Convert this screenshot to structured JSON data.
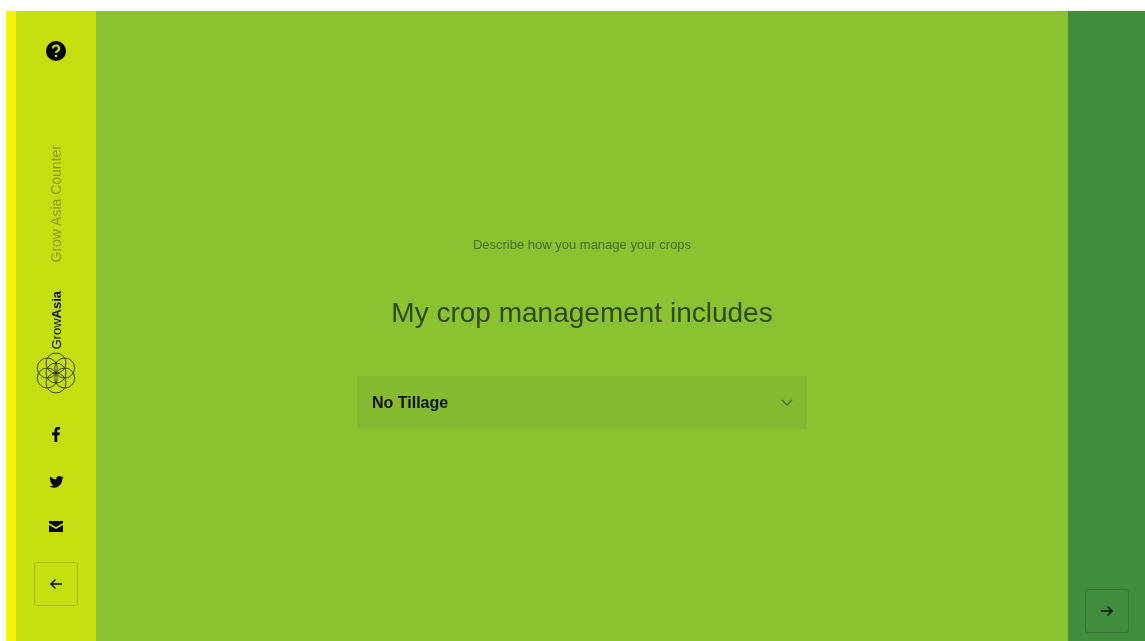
{
  "sidebar": {
    "app_title": "Grow Asia Counter",
    "logo_text": "Grow**Asia**"
  },
  "question": {
    "hint": "Describe how you manage your crops",
    "title": "My crop management includes",
    "dropdown": {
      "value": "No Tillage"
    }
  }
}
